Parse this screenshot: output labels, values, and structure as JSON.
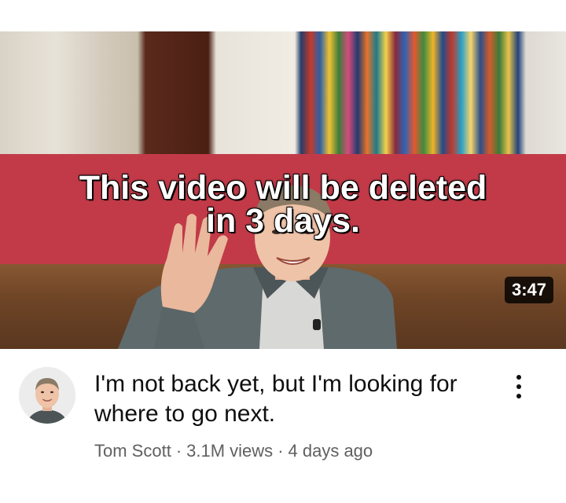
{
  "video": {
    "thumbnail_text_line1": "This video will be deleted",
    "thumbnail_text_line2": "in 3 days.",
    "duration": "3:47",
    "title": "I'm not back yet, but I'm looking for where to go next.",
    "channel": "Tom Scott",
    "views": "3.1M views",
    "published": "4 days ago",
    "separator": "·",
    "more_icon": "more-vert-icon"
  },
  "colors": {
    "banner": "#c23a48",
    "title_text": "#0f0f0f",
    "meta_text": "#606060",
    "badge_bg": "#000000"
  }
}
